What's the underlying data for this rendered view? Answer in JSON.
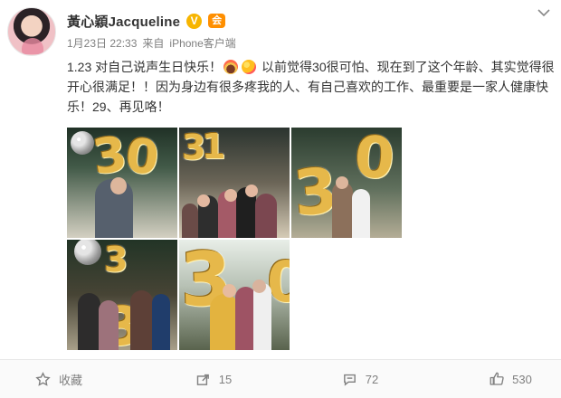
{
  "user": {
    "display_name": "黃心穎Jacqueline",
    "verified_mark": "V",
    "member_mark": "会"
  },
  "post": {
    "date": "1月23日 22:33",
    "source_prefix": "来自",
    "source_name": "iPhone客户端",
    "text_part1": "1.23 对自己说声生日快乐！",
    "text_part2": " 以前觉得30很可怕、现在到了这个年龄、其实觉得很开心很满足！！因为身边有很多疼我的人、有自己喜欢的工作、最重要是一家人健康快乐！29、再见咯！"
  },
  "photos": [
    {
      "icon": "birthday-photo-30-balloons"
    },
    {
      "icon": "family-birthday-group-photo"
    },
    {
      "icon": "birthday-photo-30-side"
    },
    {
      "icon": "family-photo-3-balloon"
    },
    {
      "icon": "birthday-kiss-photo-30"
    }
  ],
  "actions": {
    "favorite_label": "收藏",
    "repost_count": "15",
    "comment_count": "72",
    "like_count": "530"
  },
  "colors": {
    "text": "#333333",
    "muted": "#808080",
    "verified": "#f7b500",
    "member": "#ff8f00",
    "divider": "#e8e8e8"
  }
}
